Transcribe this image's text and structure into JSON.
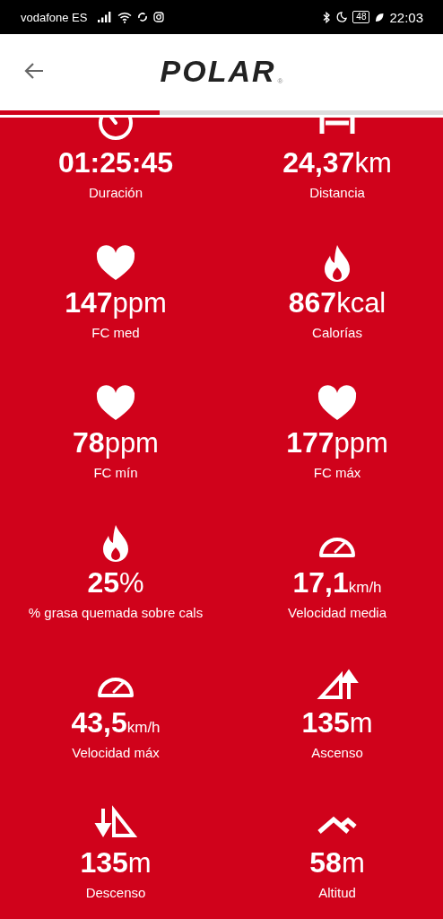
{
  "status_bar": {
    "carrier": "vodafone ES",
    "battery": "48",
    "time": "22:03"
  },
  "header": {
    "logo": "POLAR",
    "logo_mark": "®"
  },
  "progress": {
    "level": 0.36
  },
  "metrics": [
    {
      "kind": "stopwatch",
      "number": "01:25:45",
      "label": "Duración"
    },
    {
      "kind": "distance",
      "number": "24,37",
      "unit": "km",
      "unit_small": false,
      "label": "Distancia"
    },
    {
      "kind": "heart",
      "number": "147",
      "unit": "ppm",
      "unit_small": false,
      "label": "FC med"
    },
    {
      "kind": "flame",
      "number": "867",
      "unit": "kcal",
      "unit_small": false,
      "label": "Calorías"
    },
    {
      "kind": "heart",
      "number": "78",
      "unit": "ppm",
      "unit_small": false,
      "label": "FC mín"
    },
    {
      "kind": "heart",
      "number": "177",
      "unit": "ppm",
      "unit_small": false,
      "label": "FC máx"
    },
    {
      "kind": "flame",
      "number": "25",
      "unit": "%",
      "unit_small": false,
      "label": "% grasa quemada sobre cals"
    },
    {
      "kind": "gauge",
      "number": "17,1",
      "unit": "km/h",
      "unit_small": true,
      "label": "Velocidad media"
    },
    {
      "kind": "gauge",
      "number": "43,5",
      "unit": "km/h",
      "unit_small": true,
      "label": "Velocidad máx"
    },
    {
      "kind": "ascent",
      "number": "135",
      "unit": "m",
      "unit_small": false,
      "label": "Ascenso"
    },
    {
      "kind": "descent",
      "number": "135",
      "unit": "m",
      "unit_small": false,
      "label": "Descenso"
    },
    {
      "kind": "altitude",
      "number": "58",
      "unit": "m",
      "unit_small": false,
      "label": "Altitud"
    }
  ]
}
